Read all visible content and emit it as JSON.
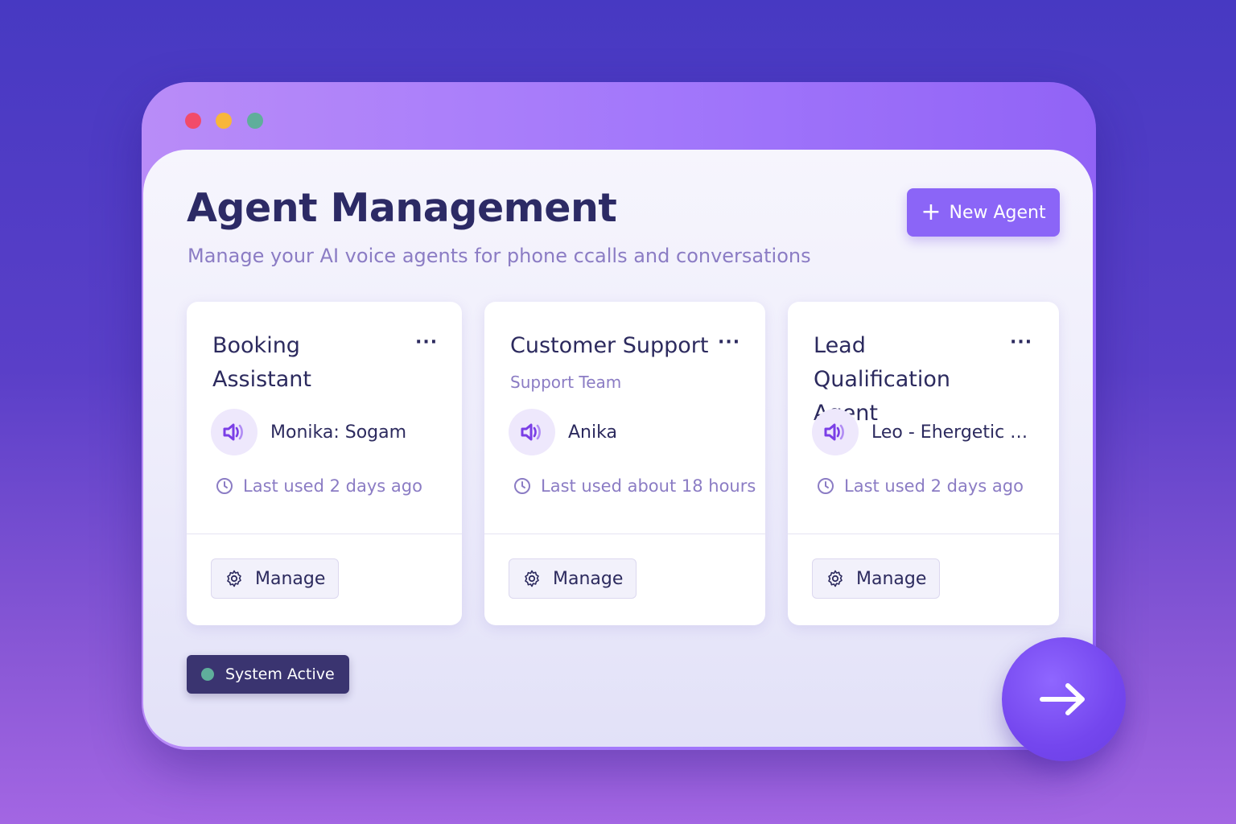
{
  "window": {
    "traffic_lights": [
      "close",
      "minimize",
      "zoom"
    ]
  },
  "header": {
    "title": "Agent Management",
    "subtitle": "Manage your AI voice agents for phone ccalls and conversations",
    "new_agent_label": "New Agent"
  },
  "agents": [
    {
      "name": "Booking Assistant",
      "team": "",
      "voice": "Monika: Sogam",
      "last_used": "Last used 2 days ago",
      "manage_label": "Manage"
    },
    {
      "name": "Customer Support",
      "team": "Support Team",
      "voice": "Anika",
      "last_used": "Last used about 18 hours",
      "manage_label": "Manage"
    },
    {
      "name": "Lead Qualification Agent",
      "team": "",
      "voice": "Leo - Ehergetic Hi...",
      "last_used": "Last used 2 days ago",
      "manage_label": "Manage"
    }
  ],
  "status": {
    "label": "System Active",
    "color": "#5fae9b"
  },
  "icons": {
    "more": "more-horizontal-icon",
    "voice": "speaker-wave-icon",
    "clock": "clock-icon",
    "gear": "gear-icon",
    "fab": "arrow-right-icon"
  },
  "colors": {
    "accent": "#8b65f7",
    "title": "#2c2a65",
    "muted": "#8b7cc4"
  }
}
